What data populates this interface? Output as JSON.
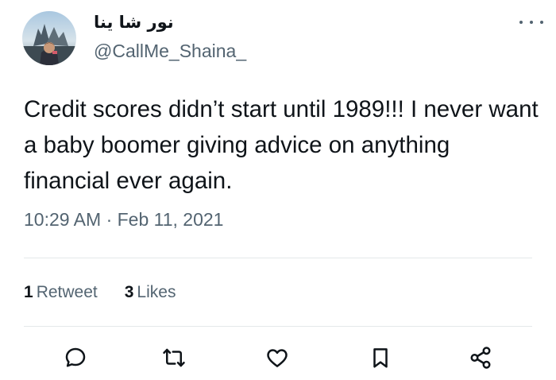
{
  "colors": {
    "text_primary": "#0f1419",
    "text_secondary": "#536471",
    "divider": "#e4e8ea"
  },
  "tweet": {
    "display_name": "نور شا ينا",
    "handle": "@CallMe_Shaina_",
    "text": "Credit scores didn’t start until 1989!!! I never want a baby boomer giving advice on anything financial ever again.",
    "timestamp": "10:29 AM · Feb 11, 2021",
    "stats": {
      "retweets_count": "1",
      "retweets_label": "Retweet",
      "likes_count": "3",
      "likes_label": "Likes"
    },
    "icons": {
      "avatar": "avatar-photo",
      "more": "more-options-icon",
      "reply": "reply-icon",
      "retweet": "retweet-icon",
      "like": "heart-icon",
      "bookmark": "bookmark-icon",
      "share": "share-icon"
    }
  }
}
